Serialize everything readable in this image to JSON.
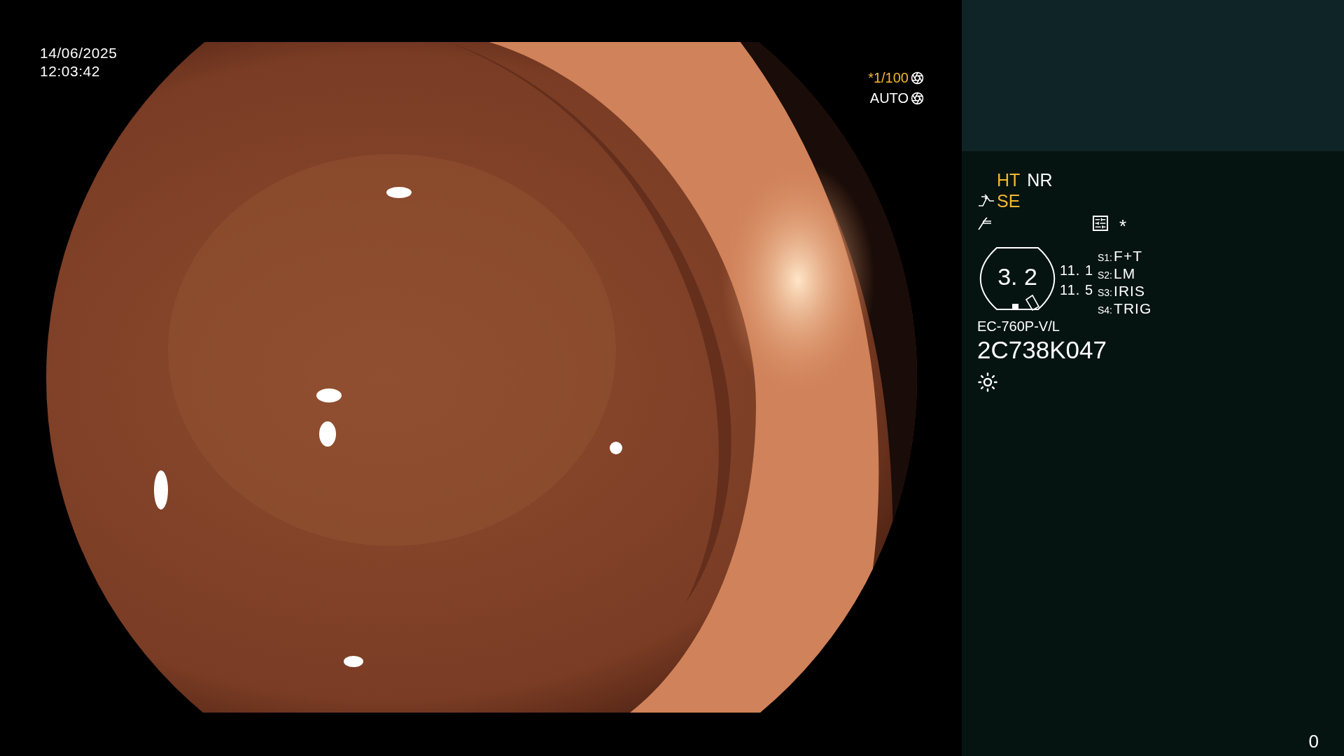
{
  "video": {
    "date": "14/06/2025",
    "time": "12:03:42",
    "shutter": {
      "value": "*1/100",
      "active": true
    },
    "iris": {
      "label": "AUTO",
      "active": false
    }
  },
  "panel": {
    "modes": [
      {
        "label": "HT",
        "active": true
      },
      {
        "label": "NR",
        "active": false
      }
    ],
    "enhance": {
      "label": "SE",
      "active": true
    },
    "memory_mark": "*",
    "zoom": "3. 2",
    "readings": [
      "11. 1",
      "11. 5"
    ],
    "switches": [
      {
        "key": "S1:",
        "value": "F+T"
      },
      {
        "key": "S2:",
        "value": "LM"
      },
      {
        "key": "S3:",
        "value": "IRIS"
      },
      {
        "key": "S4:",
        "value": "TRIG"
      }
    ],
    "scope_model": "EC-760P-V/L",
    "serial": "2C738K047"
  },
  "counter": "0"
}
